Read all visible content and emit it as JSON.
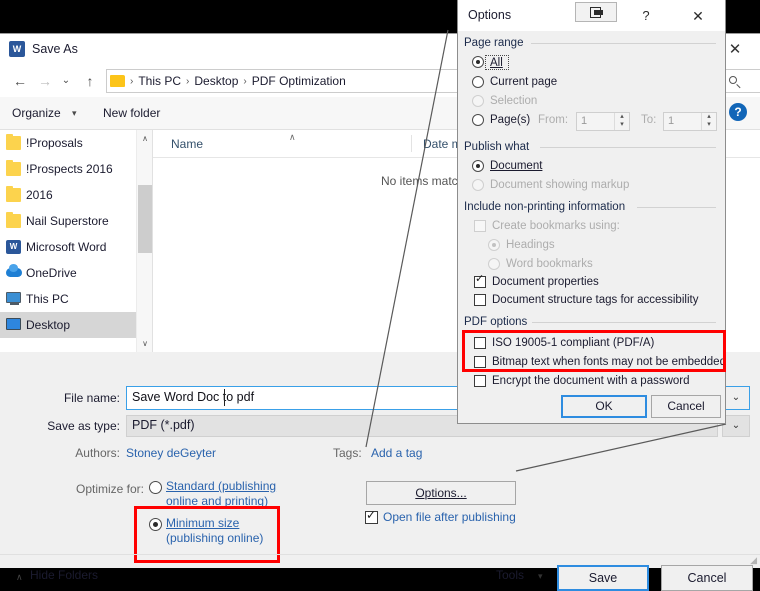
{
  "saveas": {
    "title": "Save As",
    "app_icon": "W",
    "close_icon": "✕",
    "nav": {
      "back_icon": "←",
      "forward_icon": "→",
      "recent_icon": "⌄",
      "up_icon": "↑"
    },
    "breadcrumb": {
      "separator": "›",
      "items": [
        "This PC",
        "Desktop",
        "PDF Optimization"
      ]
    },
    "search_placeholder": "",
    "search_icon": "search-icon",
    "toolbar": {
      "organize": "Organize",
      "organize_caret": "▾",
      "new_folder": "New folder",
      "help_label": "?"
    },
    "navpane": {
      "scroll_up": "∧",
      "scroll_down": "∨",
      "items": [
        {
          "label": "!Proposals",
          "icon": "folder",
          "selected": false
        },
        {
          "label": "!Prospects 2016",
          "icon": "folder",
          "selected": false
        },
        {
          "label": "2016",
          "icon": "folder",
          "selected": false
        },
        {
          "label": "Nail Superstore",
          "icon": "folder",
          "selected": false
        },
        {
          "label": "Microsoft Word",
          "icon": "word",
          "selected": false
        },
        {
          "label": "OneDrive",
          "icon": "onedrive",
          "selected": false
        },
        {
          "label": "This PC",
          "icon": "pc",
          "selected": false
        },
        {
          "label": "Desktop",
          "icon": "desktop",
          "selected": true
        }
      ]
    },
    "filelist": {
      "col_name": "Name",
      "col_name_sort_icon": "∧",
      "col_date": "Date m",
      "empty_message": "No items matc"
    },
    "file_name_label": "File name:",
    "file_name_value": "Save Word Doc to pdf",
    "save_as_type_label": "Save as type:",
    "save_as_type_value": "PDF (*.pdf)",
    "dropdown_caret": "⌄",
    "authors_label": "Authors:",
    "authors_value": "Stoney deGeyter",
    "tags_label": "Tags:",
    "tags_value": "Add a tag",
    "optimize_label": "Optimize for:",
    "optimize_options": [
      {
        "label_line1": "Standard (publishing",
        "label_line2": "online and printing)",
        "selected": false
      },
      {
        "label_line1": "Minimum size",
        "label_line2": "(publishing online)",
        "selected": true
      }
    ],
    "options_button": "Options...",
    "open_after_publishing_label": "Open file after publishing",
    "open_after_publishing_checked": true,
    "hide_folders": "Hide Folders",
    "hide_folders_caret": "∧",
    "tools_button": "Tools",
    "tools_caret": "▾",
    "save_button": "Save",
    "cancel_button": "Cancel",
    "resize_grip": "◢"
  },
  "options_dialog": {
    "title": "Options",
    "restore_icon": "restore-window-icon",
    "help_icon": "?",
    "close_icon": "✕",
    "page_range": {
      "group_title": "Page range",
      "all": "All",
      "current_page": "Current page",
      "selection": "Selection",
      "pages": "Page(s)",
      "from_label": "From:",
      "from_value": "1",
      "to_label": "To:",
      "to_value": "1",
      "selected": "all",
      "spin_up": "▴",
      "spin_down": "▾"
    },
    "publish_what": {
      "group_title": "Publish what",
      "document": "Document",
      "document_showing_markup": "Document showing markup",
      "selected": "document"
    },
    "non_printing": {
      "group_title": "Include non-printing information",
      "create_bookmarks": "Create bookmarks using:",
      "create_bookmarks_checked": false,
      "headings": "Headings",
      "word_bookmarks": "Word bookmarks",
      "bookmark_source_selected": "headings",
      "document_properties": "Document properties",
      "document_properties_checked": true,
      "structure_tags": "Document structure tags for accessibility",
      "structure_tags_checked": false
    },
    "pdf_options": {
      "group_title": "PDF options",
      "iso": "ISO 19005-1 compliant (PDF/A)",
      "iso_checked": false,
      "bitmap": "Bitmap text when fonts may not be embedded",
      "bitmap_checked": false,
      "encrypt": "Encrypt the document with a password",
      "encrypt_checked": false
    },
    "ok_button": "OK",
    "cancel_button": "Cancel"
  },
  "annotations": {
    "highlight_color": "#ff0000",
    "boxes": [
      "minimum-size-option",
      "pdf-options-iso-and-bitmap"
    ]
  }
}
